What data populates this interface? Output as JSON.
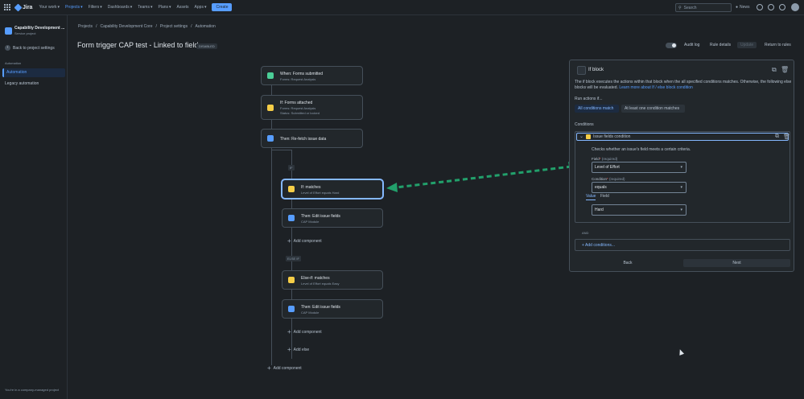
{
  "topnav": {
    "logo": "Jira",
    "items": [
      "Your work",
      "Projects",
      "Filters",
      "Dashboards",
      "Teams",
      "Plans",
      "Assets",
      "Apps"
    ],
    "create": "Create",
    "search_placeholder": "Search",
    "news": "News"
  },
  "sidebar": {
    "project_name": "Capability Development ...",
    "project_type": "Service project",
    "back": "Back to project settings",
    "section": "Automation",
    "items": [
      "Automation",
      "Legacy automation"
    ],
    "footer": "You're in a company-managed project"
  },
  "breadcrumb": [
    "Projects",
    "/",
    "Capability Development Core",
    "/",
    "Project settings",
    "/",
    "Automation"
  ],
  "header": {
    "title": "Form trigger CAP test - Linked to field",
    "badge": "DISABLED",
    "audit_log": "Audit log",
    "rule_details": "Rule details",
    "update": "Update",
    "return": "Return to rules"
  },
  "flow": {
    "nodes": [
      {
        "title": "When: Forms submitted",
        "sub": [
          "Forms: Request Analysis"
        ]
      },
      {
        "title": "If: Forms attached",
        "sub": [
          "Forms: Request Analysis",
          "Status: Submitted or locked"
        ]
      },
      {
        "title": "Then: Re-fetch issue data",
        "sub": []
      },
      {
        "title": "If: matches",
        "sub": [
          "Level of Effort equals Hard"
        ]
      },
      {
        "title": "Then: Edit issue fields",
        "sub": [
          "CAP Module"
        ]
      },
      {
        "title": "Else-if: matches",
        "sub": [
          "Level of Effort equals Easy"
        ]
      },
      {
        "title": "Then: Edit issue fields",
        "sub": [
          "CAP Module"
        ]
      }
    ],
    "badge_if": "IF",
    "badge_else": "ELSE IF",
    "add_component": "Add component",
    "add_else": "Add else"
  },
  "panel": {
    "title": "If block",
    "desc": "The if block executes the actions within that block when the all specified conditions matches. Otherwise, the following else blocks will be evaluated.",
    "link": "Learn more about If / else block condition",
    "run_label": "Run actions if...",
    "seg_all": "All conditions match",
    "seg_any": "At least one condition matches",
    "conditions_label": "Conditions",
    "cond_name": "Issue fields condition",
    "cond_desc": "Checks whether an issue's field meets a certain criteria.",
    "field_label": "Field",
    "condition_label": "Condition",
    "required_hint": "(required)",
    "field_value": "Level of Effort",
    "condition_value": "equals",
    "tab_value": "Value",
    "tab_field": "Field",
    "value_value": "Hard",
    "and": "AND",
    "add_conditions": "Add conditions...",
    "back": "Back",
    "next": "Next"
  },
  "colors": {
    "accent": "#579dff",
    "arrow": "#22a06b",
    "background": "#1d2125"
  }
}
